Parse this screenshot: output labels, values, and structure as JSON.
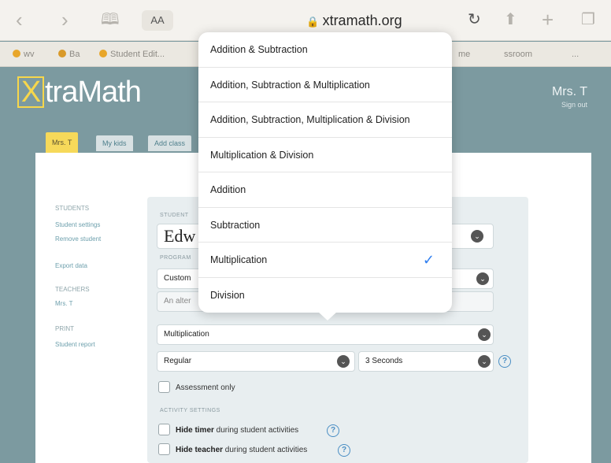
{
  "browser": {
    "aa_label": "AA",
    "url": "xtramath.org",
    "tabs": [
      "wv",
      "Ba",
      "Student Edit...",
      "me",
      "ssroom",
      "..."
    ]
  },
  "header": {
    "logo_x": "X",
    "logo_rest": "traMath",
    "user": "Mrs. T",
    "sign_out": "Sign out"
  },
  "page_tabs": [
    "Mrs. T",
    "My kids",
    "Add class"
  ],
  "sidebar": {
    "students_heading": "STUDENTS",
    "student_settings": "Student settings",
    "remove_student": "Remove student",
    "export_data": "Export data",
    "teachers_heading": "TEACHERS",
    "teacher_name": "Mrs. T",
    "print_heading": "PRINT",
    "student_report": "Student report"
  },
  "form": {
    "student_label": "STUDENT",
    "student_name": "Edw",
    "program_label": "PROGRAM",
    "program_value": "Custom",
    "program_note": "An alter",
    "operation_value": "Multiplication",
    "mode_value": "Regular",
    "time_value": "3 Seconds",
    "assessment_only": "Assessment only",
    "activity_settings_label": "ACTIVITY SETTINGS",
    "hide_timer_bold": "Hide timer",
    "hide_timer_rest": " during student activities",
    "hide_teacher_bold": "Hide teacher",
    "hide_teacher_rest": " during student activities"
  },
  "dropdown": {
    "options": [
      "Addition & Subtraction",
      "Addition, Subtraction & Multiplication",
      "Addition, Subtraction, Multiplication & Division",
      "Multiplication & Division",
      "Addition",
      "Subtraction",
      "Multiplication",
      "Division"
    ],
    "selected_index": 6,
    "accent": "#2f7ef0"
  },
  "colors": {
    "header_bg": "#7c9aa0",
    "logo_accent": "#f7d74b",
    "active_tab": "#f6d95a"
  }
}
